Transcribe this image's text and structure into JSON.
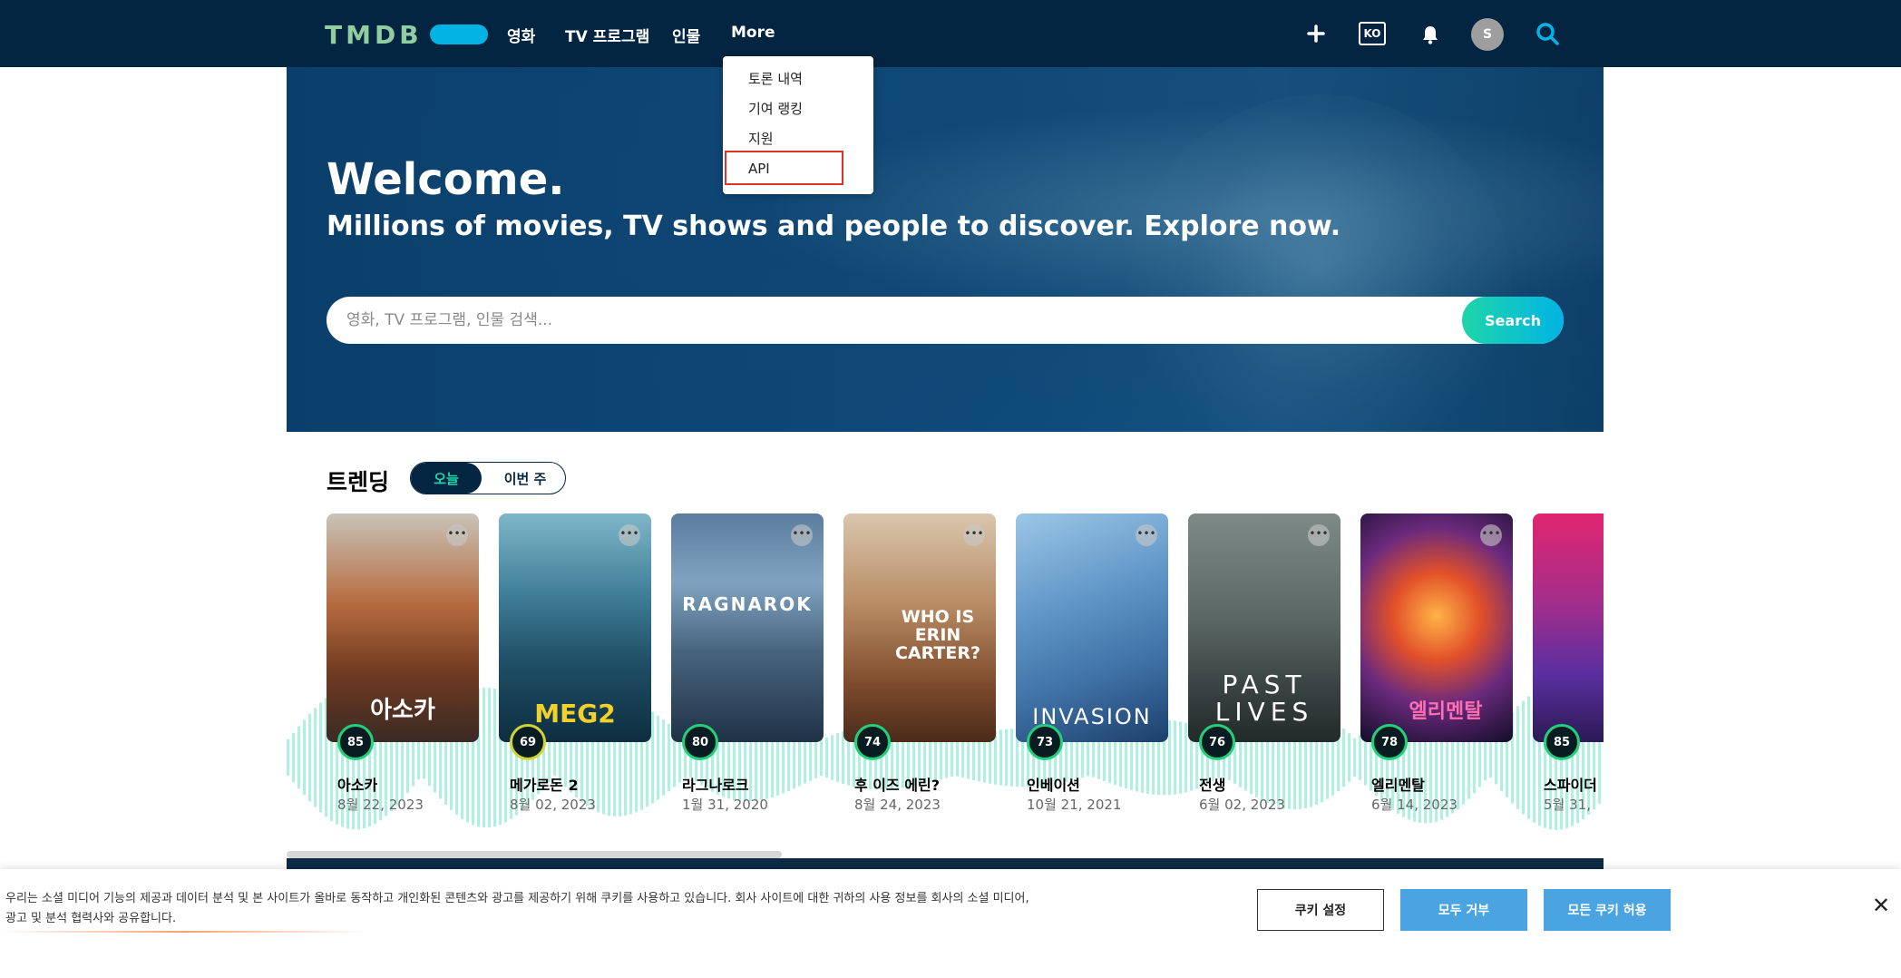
{
  "header": {
    "logo": "TMDB",
    "nav": [
      "영화",
      "TV 프로그램",
      "인물",
      "More"
    ],
    "add_icon": "plus-icon",
    "lang": "KO",
    "bell_icon": "bell-icon",
    "avatar_letter": "S",
    "search_icon": "search-icon",
    "bg_color": "#032541",
    "logo_color": "#90cea1",
    "pill_color": "#01b4e4"
  },
  "more_menu": {
    "items": [
      "토론 내역",
      "기여 랭킹",
      "지원",
      "API"
    ],
    "highlighted": "API",
    "highlight_color": "#e0312b"
  },
  "hero": {
    "title": "Welcome.",
    "subtitle": "Millions of movies, TV shows and people to discover. Explore now.",
    "search_placeholder": "영화, TV 프로그램, 인물 검색...",
    "search_button": "Search"
  },
  "trending": {
    "title": "트렌딩",
    "toggle_active": "오늘",
    "toggle_inactive": "이번 주",
    "items": [
      {
        "title": "아소카",
        "date": "8월 22, 2023",
        "score": "85",
        "poster_text": "아소카"
      },
      {
        "title": "메가로돈 2",
        "date": "8월 02, 2023",
        "score": "69",
        "poster_text": "MEG2"
      },
      {
        "title": "라그나로크",
        "date": "1월 31, 2020",
        "score": "80",
        "poster_text": "RAGNAROK"
      },
      {
        "title": "후 이즈 에린?",
        "date": "8월 24, 2023",
        "score": "74",
        "poster_text": "WHO IS ERIN CARTER?"
      },
      {
        "title": "인베이션",
        "date": "10월 21, 2021",
        "score": "73",
        "poster_text": "INVASION"
      },
      {
        "title": "전생",
        "date": "6월 02, 2023",
        "score": "76",
        "poster_text": "PAST LIVES"
      },
      {
        "title": "엘리멘탈",
        "date": "6월 14, 2023",
        "score": "78",
        "poster_text": "엘리멘탈"
      },
      {
        "title": "스파이더",
        "date": "5월 31,",
        "score": "85",
        "poster_text": ""
      }
    ]
  },
  "cookie": {
    "text": "우리는 소셜 미디어 기능의 제공과 데이터 분석 및 본 사이트가 올바로 동작하고 개인화된 콘텐츠와 광고를 제공하기 위해 쿠키를 사용하고 있습니다. 회사 사이트에 대한 귀하의 사용 정보를 회사의 소셜 미디어, 광고 및 분석 협력사와 공유합니다.",
    "settings": "쿠키 설정",
    "reject_all": "모두 거부",
    "accept_all": "모든 쿠키 허용",
    "close_icon": "close-icon",
    "button_color": "#4aa4e2"
  }
}
